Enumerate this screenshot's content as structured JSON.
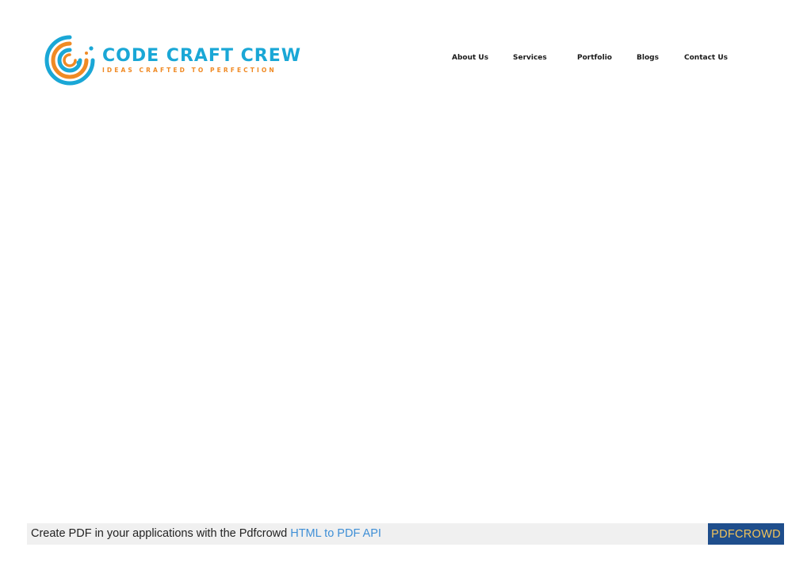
{
  "brand": {
    "name": "CODE CRAFT CREW",
    "tagline": "IDEAS CRAFTED TO PERFECTION",
    "colors": {
      "primary": "#1aa7d6",
      "accent": "#f08a24"
    }
  },
  "nav": {
    "items": [
      {
        "label": "About Us"
      },
      {
        "label": "Services"
      },
      {
        "label": "Portfolio"
      },
      {
        "label": "Blogs"
      },
      {
        "label": "Contact Us"
      }
    ]
  },
  "footer": {
    "text": "Create PDF in your applications with the Pdfcrowd",
    "link_label": "HTML to PDF API",
    "brand_label": "PDFCROWD",
    "colors": {
      "link": "#3f8fd6",
      "brand_bg": "#1f4e8c",
      "brand_fg": "#f2c45a"
    }
  }
}
